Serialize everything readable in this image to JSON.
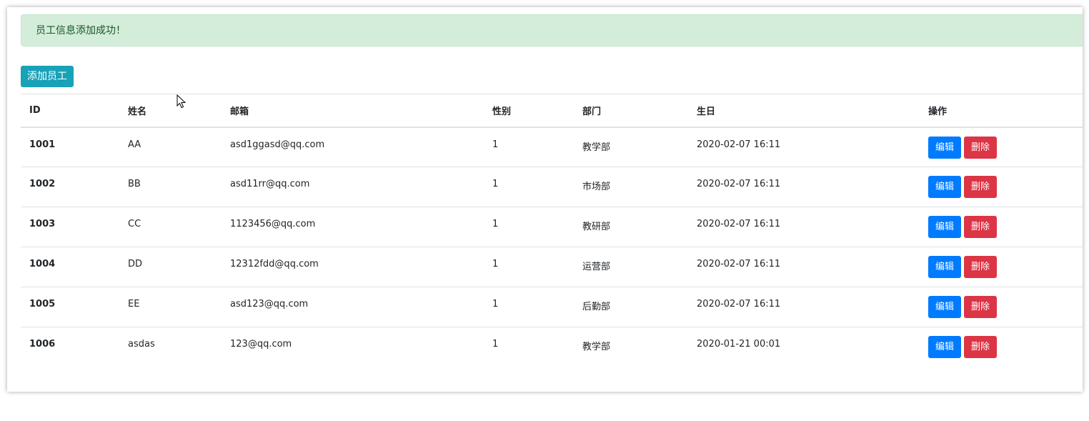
{
  "alert": {
    "message": "员工信息添加成功！"
  },
  "toolbar": {
    "add_label": "添加员工"
  },
  "table": {
    "headers": [
      "ID",
      "姓名",
      "邮箱",
      "性别",
      "部门",
      "生日",
      "操作"
    ],
    "rows": [
      {
        "id": "1001",
        "name": "AA",
        "email": "asd1ggasd@qq.com",
        "gender": "1",
        "department": "教学部",
        "birth": "2020-02-07 16:11"
      },
      {
        "id": "1002",
        "name": "BB",
        "email": "asd11rr@qq.com",
        "gender": "1",
        "department": "市场部",
        "birth": "2020-02-07 16:11"
      },
      {
        "id": "1003",
        "name": "CC",
        "email": "1123456@qq.com",
        "gender": "1",
        "department": "教研部",
        "birth": "2020-02-07 16:11"
      },
      {
        "id": "1004",
        "name": "DD",
        "email": "12312fdd@qq.com",
        "gender": "1",
        "department": "运营部",
        "birth": "2020-02-07 16:11"
      },
      {
        "id": "1005",
        "name": "EE",
        "email": "asd123@qq.com",
        "gender": "1",
        "department": "后勤部",
        "birth": "2020-02-07 16:11"
      },
      {
        "id": "1006",
        "name": "asdas",
        "email": "123@qq.com",
        "gender": "1",
        "department": "教学部",
        "birth": "2020-01-21 00:01"
      }
    ],
    "edit_label": "编辑",
    "delete_label": "删除"
  },
  "colors": {
    "alert_bg": "#d4edda",
    "add_button": "#17a2b8",
    "edit_button": "#007bff",
    "delete_button": "#dc3545"
  },
  "icons": {
    "cursor": "mouse-pointer-icon"
  }
}
